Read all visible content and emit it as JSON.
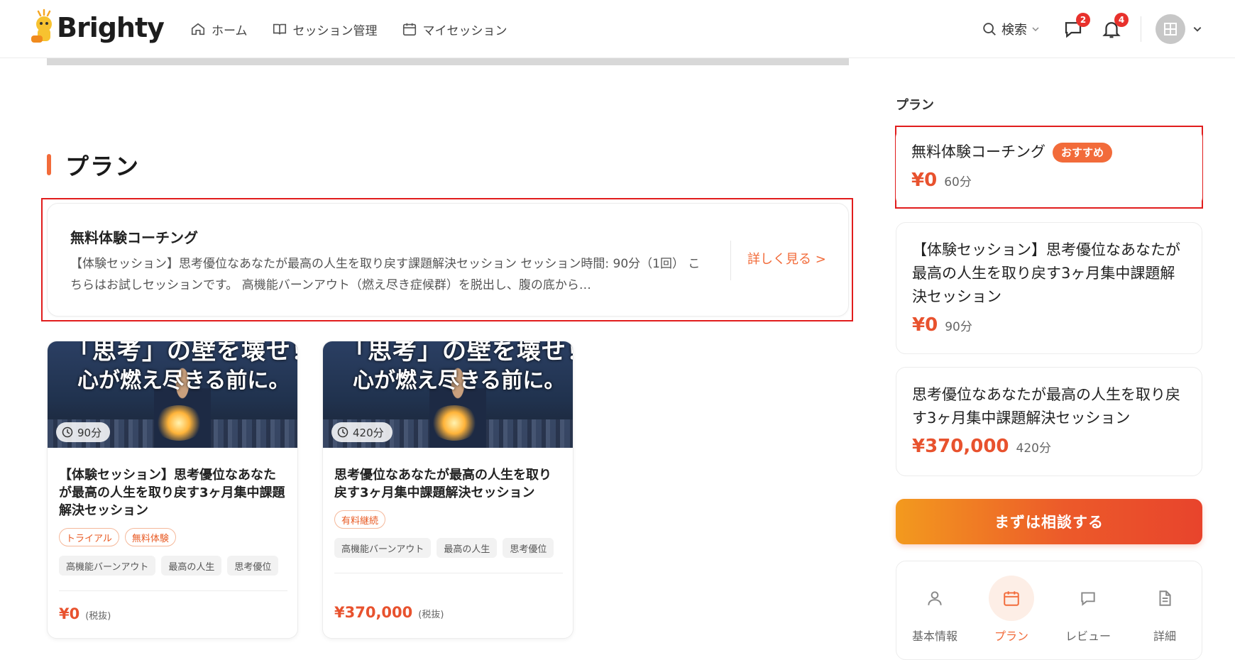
{
  "header": {
    "logo_text": "Brighty",
    "nav": [
      {
        "label": "ホーム",
        "icon": "home-icon"
      },
      {
        "label": "セッション管理",
        "icon": "book-icon"
      },
      {
        "label": "マイセッション",
        "icon": "calendar-icon"
      }
    ],
    "search_label": "検索",
    "messages_badge": "2",
    "notifications_badge": "4"
  },
  "main": {
    "section_title": "プラン",
    "plan_card": {
      "title": "無料体験コーチング",
      "description": "【体験セッション】思考優位なあなたが最高の人生を取り戻す課題解決セッション セッション時間: 90分（1回） こちらはお試しセッションです。 高機能バーンアウト（燃え尽き症候群）を脱出し、腹の底から…",
      "link": "詳しく見る >"
    },
    "session_cards": [
      {
        "image_line1": "「思考」の壁を壊せ！",
        "image_line2": "心が燃え尽きる前に。",
        "duration": "90分",
        "title": "【体験セッション】思考優位なあなたが最高の人生を取り戻す3ヶ月集中課題解決セッション",
        "orange_tags": [
          "トライアル",
          "無料体験"
        ],
        "grey_tags": [
          "高機能バーンアウト",
          "最高の人生",
          "思考優位"
        ],
        "price": "¥0",
        "tax": "(税抜)"
      },
      {
        "image_line1": "「思考」の壁を壊せ！",
        "image_line2": "心が燃え尽きる前に。",
        "duration": "420分",
        "title": "思考優位なあなたが最高の人生を取り戻す3ヶ月集中課題解決セッション",
        "orange_tags": [
          "有料継続"
        ],
        "grey_tags": [
          "高機能バーンアウト",
          "最高の人生",
          "思考優位"
        ],
        "price": "¥370,000",
        "tax": "(税抜)"
      }
    ]
  },
  "sidebar": {
    "heading": "プラン",
    "plans": [
      {
        "title": "無料体験コーチング",
        "badge": "おすすめ",
        "price": "¥0",
        "duration": "60分"
      },
      {
        "title": "【体験セッション】思考優位なあなたが最高の人生を取り戻す3ヶ月集中課題解決セッション",
        "price": "¥0",
        "duration": "90分"
      },
      {
        "title": "思考優位なあなたが最高の人生を取り戻す3ヶ月集中課題解決セッション",
        "price": "¥370,000",
        "duration": "420分"
      }
    ],
    "cta": "まずは相談する",
    "tabs": [
      {
        "label": "基本情報",
        "icon": "person-icon"
      },
      {
        "label": "プラン",
        "icon": "calendar-icon",
        "active": true
      },
      {
        "label": "レビュー",
        "icon": "chat-icon"
      },
      {
        "label": "詳細",
        "icon": "document-icon"
      }
    ]
  },
  "colors": {
    "accent": "#f26b3a",
    "price": "#e8522e",
    "highlight": "#e11d1d"
  }
}
